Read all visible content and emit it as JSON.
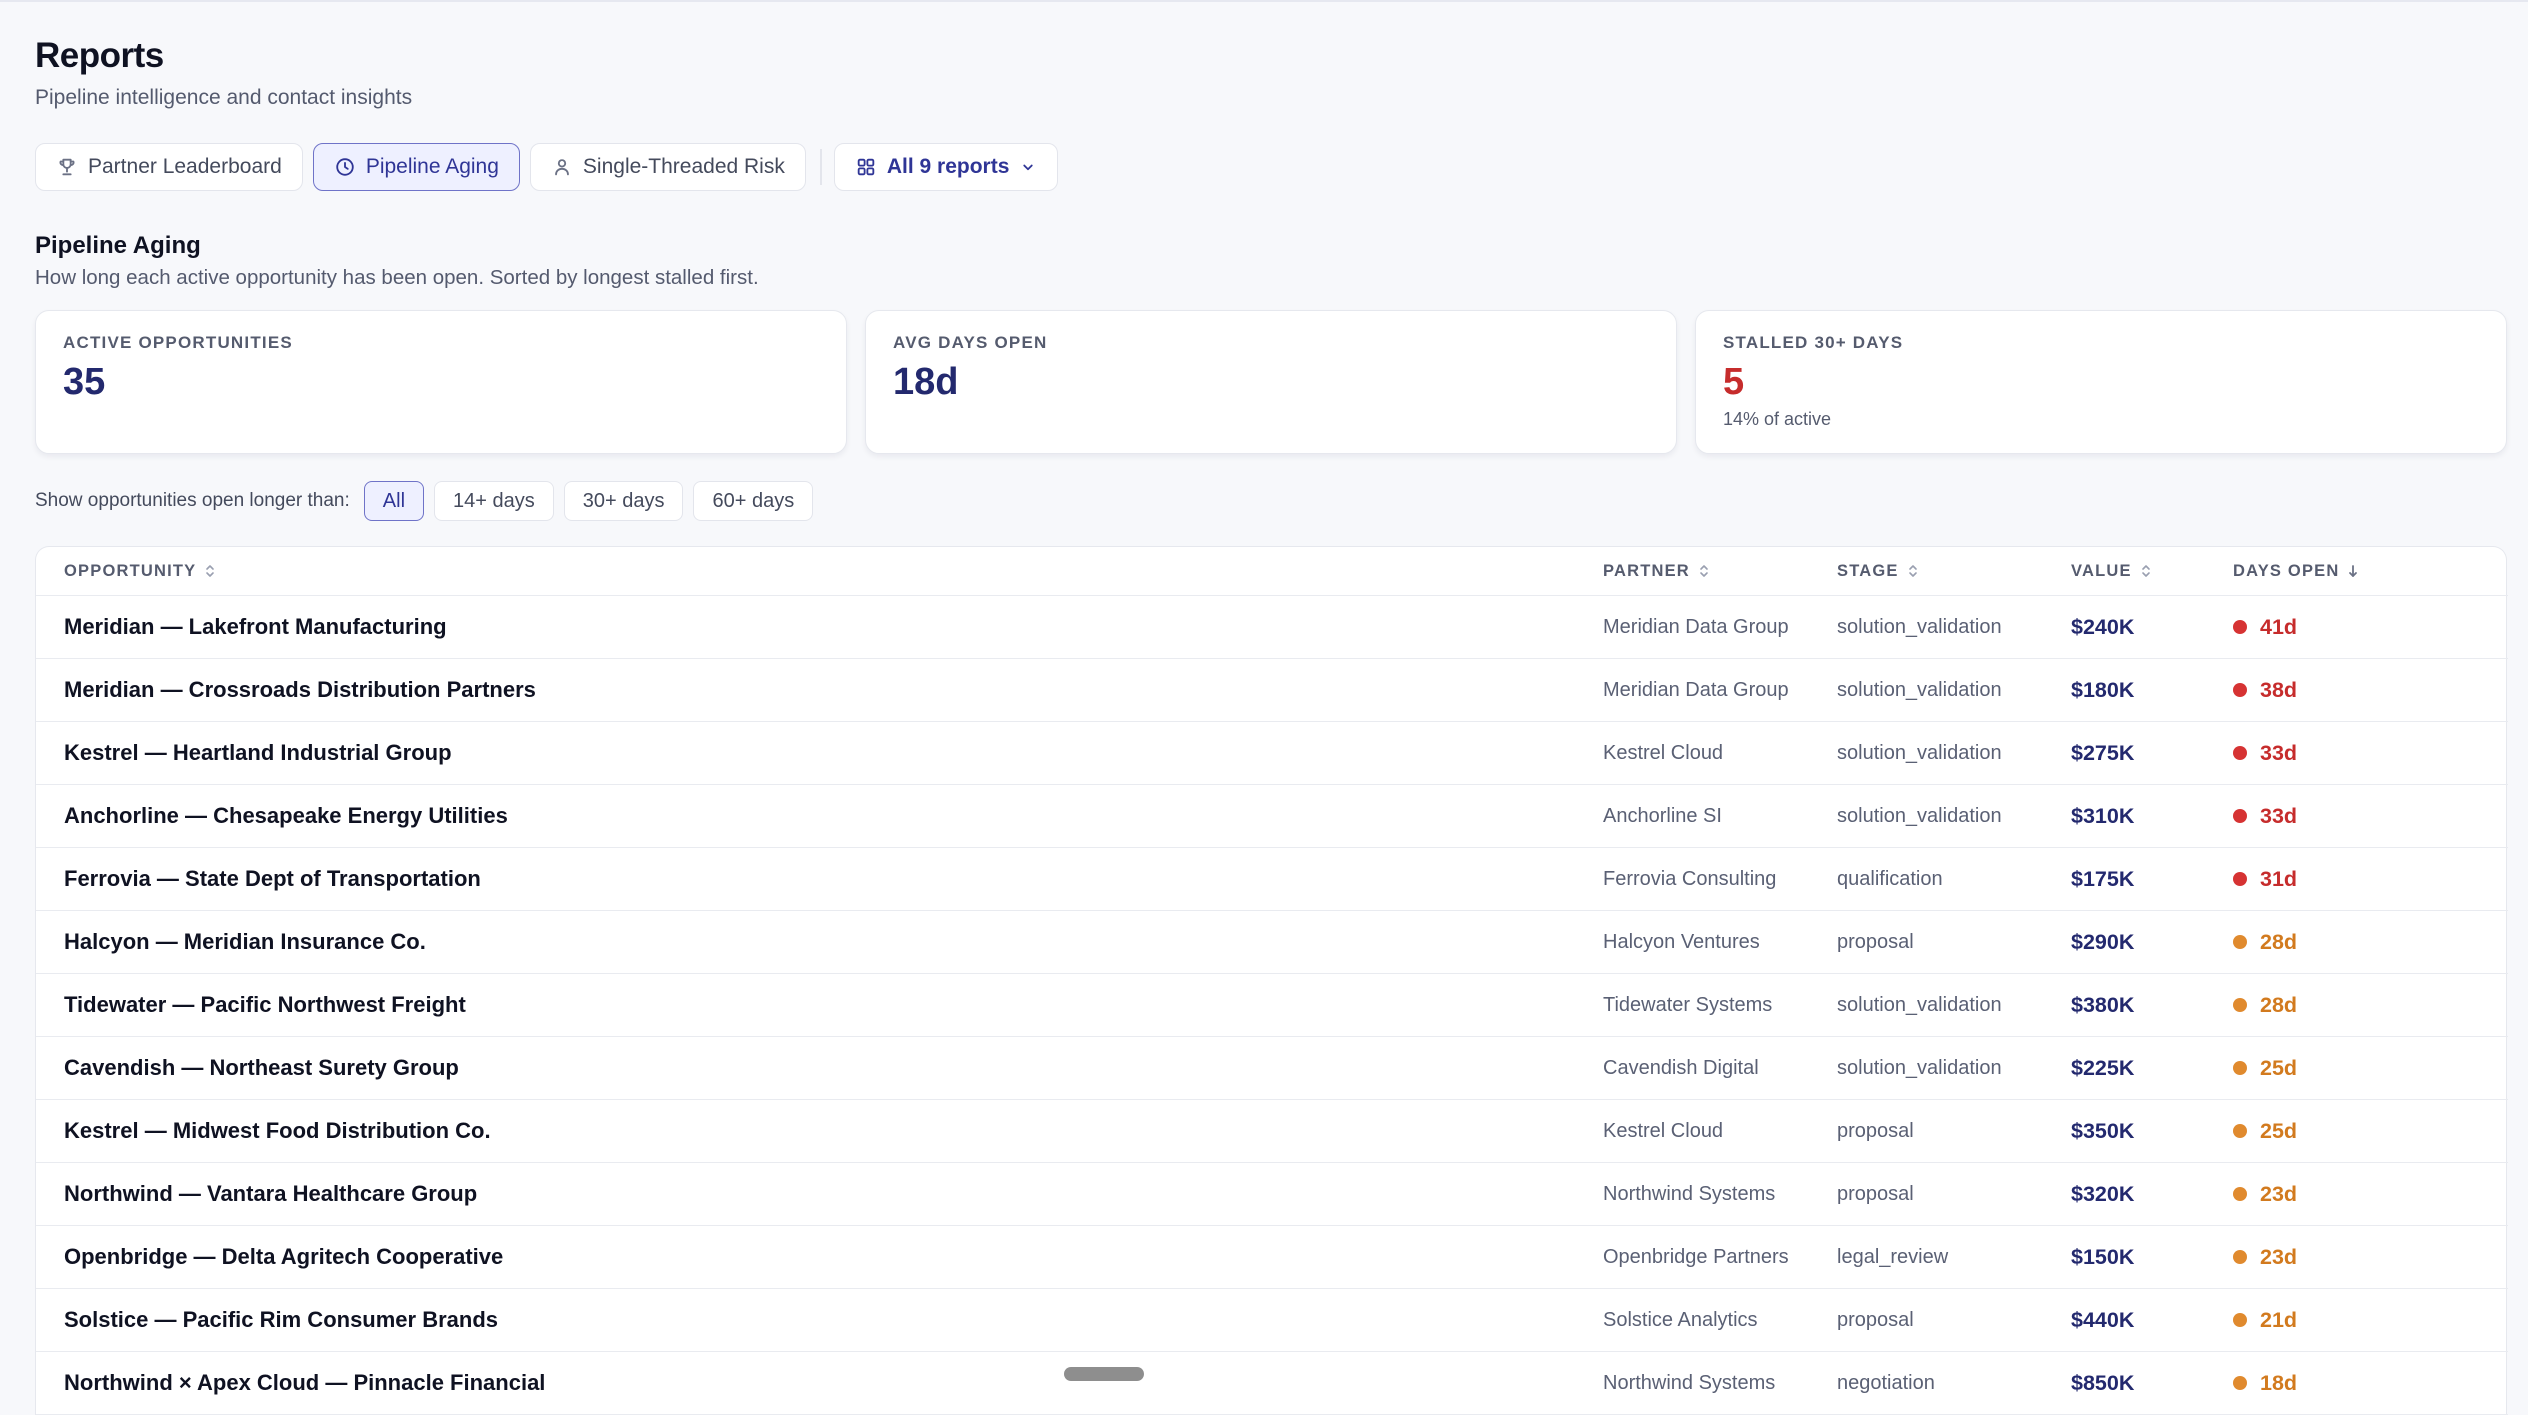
{
  "header": {
    "title": "Reports",
    "subtitle": "Pipeline intelligence and contact insights"
  },
  "tabs": [
    {
      "label": "Partner Leaderboard",
      "icon": "trophy-icon",
      "active": false
    },
    {
      "label": "Pipeline Aging",
      "icon": "clock-icon",
      "active": true
    },
    {
      "label": "Single-Threaded Risk",
      "icon": "user-icon",
      "active": false
    }
  ],
  "all_reports": {
    "label": "All 9 reports",
    "icon": "grid-icon"
  },
  "section": {
    "title": "Pipeline Aging",
    "description": "How long each active opportunity has been open. Sorted by longest stalled first."
  },
  "cards": [
    {
      "label": "ACTIVE OPPORTUNITIES",
      "value": "35",
      "sub": ""
    },
    {
      "label": "AVG DAYS OPEN",
      "value": "18d",
      "sub": ""
    },
    {
      "label": "STALLED 30+ DAYS",
      "value": "5",
      "sub": "14% of active"
    }
  ],
  "filter": {
    "label": "Show opportunities open longer than:",
    "options": [
      "All",
      "14+ days",
      "30+ days",
      "60+ days"
    ],
    "selected": "All"
  },
  "table": {
    "columns": {
      "opportunity": "OPPORTUNITY",
      "partner": "PARTNER",
      "stage": "STAGE",
      "value": "VALUE",
      "days": "DAYS OPEN"
    },
    "rows": [
      {
        "opportunity": "Meridian — Lakefront Manufacturing",
        "partner": "Meridian Data Group",
        "stage": "solution_validation",
        "value": "$240K",
        "days": "41d",
        "level": "red"
      },
      {
        "opportunity": "Meridian — Crossroads Distribution Partners",
        "partner": "Meridian Data Group",
        "stage": "solution_validation",
        "value": "$180K",
        "days": "38d",
        "level": "red"
      },
      {
        "opportunity": "Kestrel — Heartland Industrial Group",
        "partner": "Kestrel Cloud",
        "stage": "solution_validation",
        "value": "$275K",
        "days": "33d",
        "level": "red"
      },
      {
        "opportunity": "Anchorline — Chesapeake Energy Utilities",
        "partner": "Anchorline SI",
        "stage": "solution_validation",
        "value": "$310K",
        "days": "33d",
        "level": "red"
      },
      {
        "opportunity": "Ferrovia — State Dept of Transportation",
        "partner": "Ferrovia Consulting",
        "stage": "qualification",
        "value": "$175K",
        "days": "31d",
        "level": "red"
      },
      {
        "opportunity": "Halcyon — Meridian Insurance Co.",
        "partner": "Halcyon Ventures",
        "stage": "proposal",
        "value": "$290K",
        "days": "28d",
        "level": "orange"
      },
      {
        "opportunity": "Tidewater — Pacific Northwest Freight",
        "partner": "Tidewater Systems",
        "stage": "solution_validation",
        "value": "$380K",
        "days": "28d",
        "level": "orange"
      },
      {
        "opportunity": "Cavendish — Northeast Surety Group",
        "partner": "Cavendish Digital",
        "stage": "solution_validation",
        "value": "$225K",
        "days": "25d",
        "level": "orange"
      },
      {
        "opportunity": "Kestrel — Midwest Food Distribution Co.",
        "partner": "Kestrel Cloud",
        "stage": "proposal",
        "value": "$350K",
        "days": "25d",
        "level": "orange"
      },
      {
        "opportunity": "Northwind — Vantara Healthcare Group",
        "partner": "Northwind Systems",
        "stage": "proposal",
        "value": "$320K",
        "days": "23d",
        "level": "orange"
      },
      {
        "opportunity": "Openbridge — Delta Agritech Cooperative",
        "partner": "Openbridge Partners",
        "stage": "legal_review",
        "value": "$150K",
        "days": "23d",
        "level": "orange"
      },
      {
        "opportunity": "Solstice — Pacific Rim Consumer Brands",
        "partner": "Solstice Analytics",
        "stage": "proposal",
        "value": "$440K",
        "days": "21d",
        "level": "orange"
      },
      {
        "opportunity": "Northwind × Apex Cloud — Pinnacle Financial",
        "partner": "Northwind Systems",
        "stage": "negotiation",
        "value": "$850K",
        "days": "18d",
        "level": "orange"
      }
    ]
  },
  "colors": {
    "accent": "#2f3596",
    "value_text": "#23296e",
    "stalled_red": "#c62c2c",
    "aging_orange": "#d27a1e",
    "dot_red": "#d63333",
    "dot_orange": "#e08a2e"
  }
}
